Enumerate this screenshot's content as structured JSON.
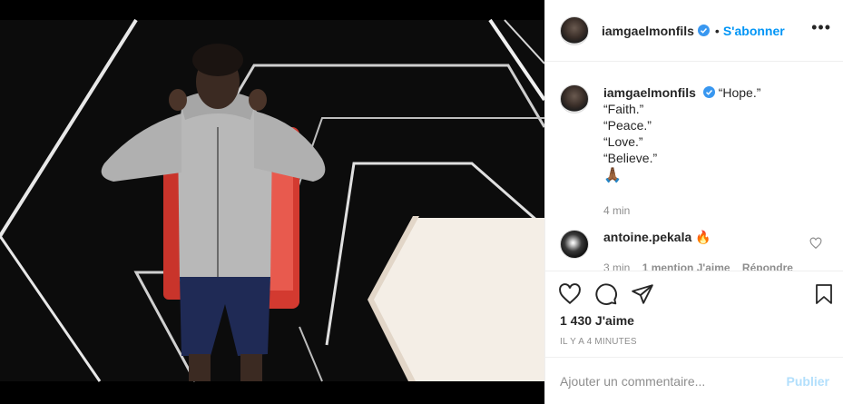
{
  "post": {
    "username": "iamgaelmonfils",
    "follow_label": "S'abonner",
    "bullet": "•",
    "more": "•••"
  },
  "caption": {
    "username": "iamgaelmonfils",
    "lines": [
      "“Hope.”",
      "“Faith.”",
      "“Peace.”",
      "“Love.”",
      "“Believe.”"
    ],
    "emoji": "🙏🏾",
    "time": "4 min"
  },
  "comment": {
    "username": "antoine.pekala",
    "emoji": "🔥",
    "time": "3 min",
    "likes": "1 mention J'aime",
    "reply": "Répondre"
  },
  "actions": {
    "likes": "1 430 J'aime",
    "ago": "IL Y A 4 MINUTES"
  },
  "add_comment": {
    "placeholder": "Ajouter un commentaire...",
    "publish": "Publier"
  },
  "colors": {
    "accent": "#0095f6",
    "publish_disabled": "#b2dffc",
    "muted": "#8e8e8e"
  }
}
